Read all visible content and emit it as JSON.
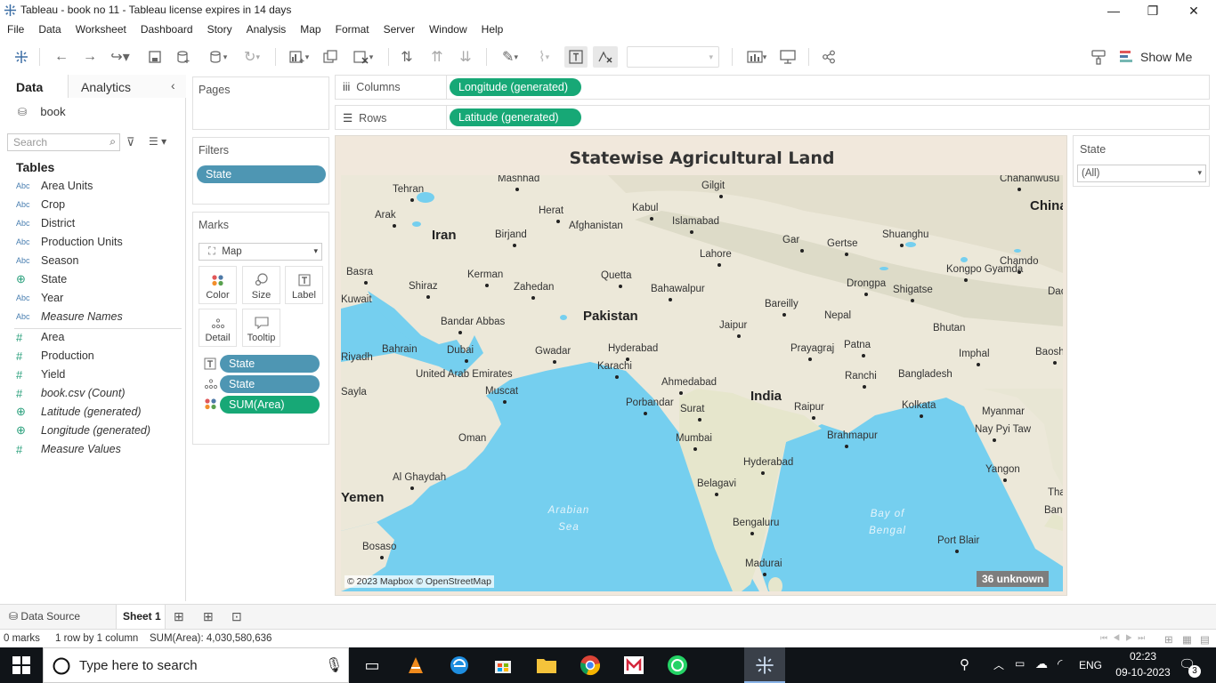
{
  "window": {
    "title": "Tableau - book no 11 - Tableau license expires in 14 days",
    "minimize": "—",
    "restore": "❐",
    "close": "✕"
  },
  "menu": [
    "File",
    "Data",
    "Worksheet",
    "Dashboard",
    "Story",
    "Analysis",
    "Map",
    "Format",
    "Server",
    "Window",
    "Help"
  ],
  "toolbar": {
    "show_me_label": "Show Me"
  },
  "left_pane": {
    "tabs": {
      "data": "Data",
      "analytics": "Analytics"
    },
    "datasource": "book",
    "search_placeholder": "Search",
    "tables_heading": "Tables",
    "fields": [
      {
        "type": "Abc",
        "name": "Area Units"
      },
      {
        "type": "Abc",
        "name": "Crop"
      },
      {
        "type": "Abc",
        "name": "District"
      },
      {
        "type": "Abc",
        "name": "Production Units"
      },
      {
        "type": "Abc",
        "name": "Season"
      },
      {
        "type": "⊕",
        "name": "State"
      },
      {
        "type": "Abc",
        "name": "Year"
      },
      {
        "type": "Abc",
        "name": "Measure Names"
      },
      {
        "type": "#",
        "name": "Area"
      },
      {
        "type": "#",
        "name": "Production"
      },
      {
        "type": "#",
        "name": "Yield"
      },
      {
        "type": "#",
        "name": "book.csv (Count)"
      },
      {
        "type": "⊕",
        "name": "Latitude (generated)"
      },
      {
        "type": "⊕",
        "name": "Longitude (generated)"
      },
      {
        "type": "#",
        "name": "Measure Values"
      }
    ]
  },
  "pages": {
    "title": "Pages"
  },
  "filters": {
    "title": "Filters",
    "items": [
      "State"
    ]
  },
  "marks": {
    "title": "Marks",
    "type": "Map",
    "buttons": [
      "Color",
      "Size",
      "Label",
      "Detail",
      "Tooltip"
    ],
    "pills": [
      "State",
      "State",
      "SUM(Area)"
    ]
  },
  "shelves": {
    "columns_label": "Columns",
    "columns_pill": "Longitude (generated)",
    "rows_label": "Rows",
    "rows_pill": "Latitude (generated)"
  },
  "worksheet": {
    "title": "Statewise Agricultural Land",
    "attribution": "© 2023 Mapbox © OpenStreetMap",
    "unknown_badge": "36 unknown",
    "map_labels": {
      "countries": [
        "Iran",
        "Pakistan",
        "India",
        "China",
        "Afghanistan",
        "Nepal",
        "Bangladesh",
        "Bhutan",
        "Myanmar",
        "Oman",
        "Yemen",
        "United Arab Emirates",
        "Bahrain",
        "Kuwait"
      ],
      "cities": [
        "Tehran",
        "Mashhad",
        "Herat",
        "Kabul",
        "Gilgit",
        "Islamabad",
        "Lahore",
        "Gar",
        "Gertse",
        "Shuanghu",
        "Chahanwusu",
        "Arak",
        "Birjand",
        "Kerman",
        "Zahedan",
        "Quetta",
        "Bahawalpur",
        "Shiraz",
        "Basra",
        "Bandar Abbas",
        "Dubai",
        "Gwadar",
        "Hyderabad",
        "Karachi",
        "Jaipur",
        "Bareilly",
        "Prayagraj",
        "Patna",
        "Drongpa",
        "Shigatse",
        "Kongpo Gyamda",
        "Chamdo",
        "Muscat",
        "Ahmedabad",
        "Porbandar",
        "Surat",
        "Mumbai",
        "Raipur",
        "Ranchi",
        "Kolkata",
        "Imphal",
        "Brahmapur",
        "Nay Pyi Taw",
        "Baoshan",
        "Hyderabad",
        "Belagavi",
        "Bengaluru",
        "Madurai",
        "Yangon",
        "Port Blair",
        "Al Ghaydah",
        "Bosaso",
        "Riyadh",
        "Sayla",
        "Daocheng",
        "Thailand",
        "Bangkok"
      ],
      "seas": [
        "Arabian Sea",
        "Bay of Bengal"
      ]
    }
  },
  "state_filter": {
    "title": "State",
    "value": "(All)"
  },
  "sheet_tabs": {
    "data_source": "Data Source",
    "active_sheet": "Sheet 1"
  },
  "status": {
    "marks": "0 marks",
    "dims": "1 row by 1 column",
    "sum": "SUM(Area): 4,030,580,636"
  },
  "taskbar": {
    "search_placeholder": "Type here to search",
    "lang": "ENG",
    "time": "02:23",
    "date": "09-10-2023",
    "notifications": "3"
  },
  "colors": {
    "pill_blue": "#4e96b3",
    "pill_green": "#17a876",
    "sea": "#75cfef",
    "land": "#eae7da",
    "sheet_bg": "#f1e8dc"
  }
}
